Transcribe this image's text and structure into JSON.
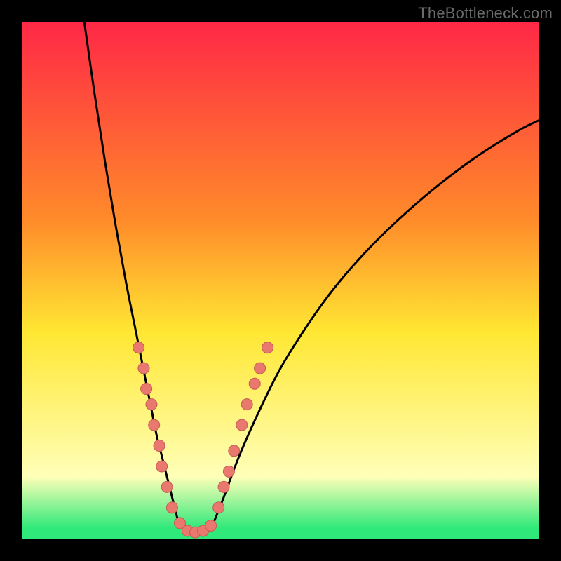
{
  "watermark": "TheBottleneck.com",
  "colors": {
    "page_bg": "#000000",
    "gradient_top": "#ff2846",
    "gradient_mid1": "#ff8a2a",
    "gradient_mid2": "#ffe733",
    "gradient_lowpale": "#ffffb8",
    "gradient_bottom": "#2fe97a",
    "curve": "#000000",
    "marker_fill": "#e9786f",
    "marker_stroke": "#c65a54"
  },
  "chart_data": {
    "type": "line",
    "title": "",
    "xlabel": "",
    "ylabel": "",
    "xlim": [
      0,
      100
    ],
    "ylim": [
      0,
      100
    ],
    "series": [
      {
        "name": "bottleneck-curve-left",
        "x": [
          12,
          14,
          16,
          18,
          20,
          22,
          24,
          25,
          26,
          27,
          28,
          29,
          30
        ],
        "y": [
          100,
          86,
          73,
          61,
          50,
          40,
          30,
          25,
          20,
          16,
          12,
          8,
          4
        ]
      },
      {
        "name": "bottleneck-curve-valley",
        "x": [
          30,
          31,
          32,
          33,
          34,
          35,
          36,
          37
        ],
        "y": [
          4,
          2,
          1,
          1,
          1,
          1,
          2,
          3
        ]
      },
      {
        "name": "bottleneck-curve-right",
        "x": [
          37,
          39,
          42,
          46,
          50,
          55,
          60,
          66,
          72,
          80,
          88,
          96,
          100
        ],
        "y": [
          3,
          8,
          16,
          25,
          33,
          41,
          48,
          55,
          61,
          68,
          74,
          79,
          81
        ]
      }
    ],
    "markers": [
      {
        "x": 22.5,
        "y": 37
      },
      {
        "x": 23.5,
        "y": 33
      },
      {
        "x": 24.0,
        "y": 29
      },
      {
        "x": 25.0,
        "y": 26
      },
      {
        "x": 25.5,
        "y": 22
      },
      {
        "x": 26.5,
        "y": 18
      },
      {
        "x": 27.0,
        "y": 14
      },
      {
        "x": 28.0,
        "y": 10
      },
      {
        "x": 29.0,
        "y": 6
      },
      {
        "x": 30.5,
        "y": 3
      },
      {
        "x": 32.0,
        "y": 1.5
      },
      {
        "x": 33.5,
        "y": 1.2
      },
      {
        "x": 35.0,
        "y": 1.5
      },
      {
        "x": 36.5,
        "y": 2.5
      },
      {
        "x": 38.0,
        "y": 6
      },
      {
        "x": 39.0,
        "y": 10
      },
      {
        "x": 40.0,
        "y": 13
      },
      {
        "x": 41.0,
        "y": 17
      },
      {
        "x": 42.5,
        "y": 22
      },
      {
        "x": 43.5,
        "y": 26
      },
      {
        "x": 45.0,
        "y": 30
      },
      {
        "x": 46.0,
        "y": 33
      },
      {
        "x": 47.5,
        "y": 37
      }
    ],
    "gradient_stops": [
      {
        "pct": 0,
        "color_key": "gradient_top"
      },
      {
        "pct": 38,
        "color_key": "gradient_mid1"
      },
      {
        "pct": 60,
        "color_key": "gradient_mid2"
      },
      {
        "pct": 88,
        "color_key": "gradient_lowpale"
      },
      {
        "pct": 98,
        "color_key": "gradient_bottom"
      },
      {
        "pct": 100,
        "color_key": "gradient_bottom"
      }
    ]
  }
}
